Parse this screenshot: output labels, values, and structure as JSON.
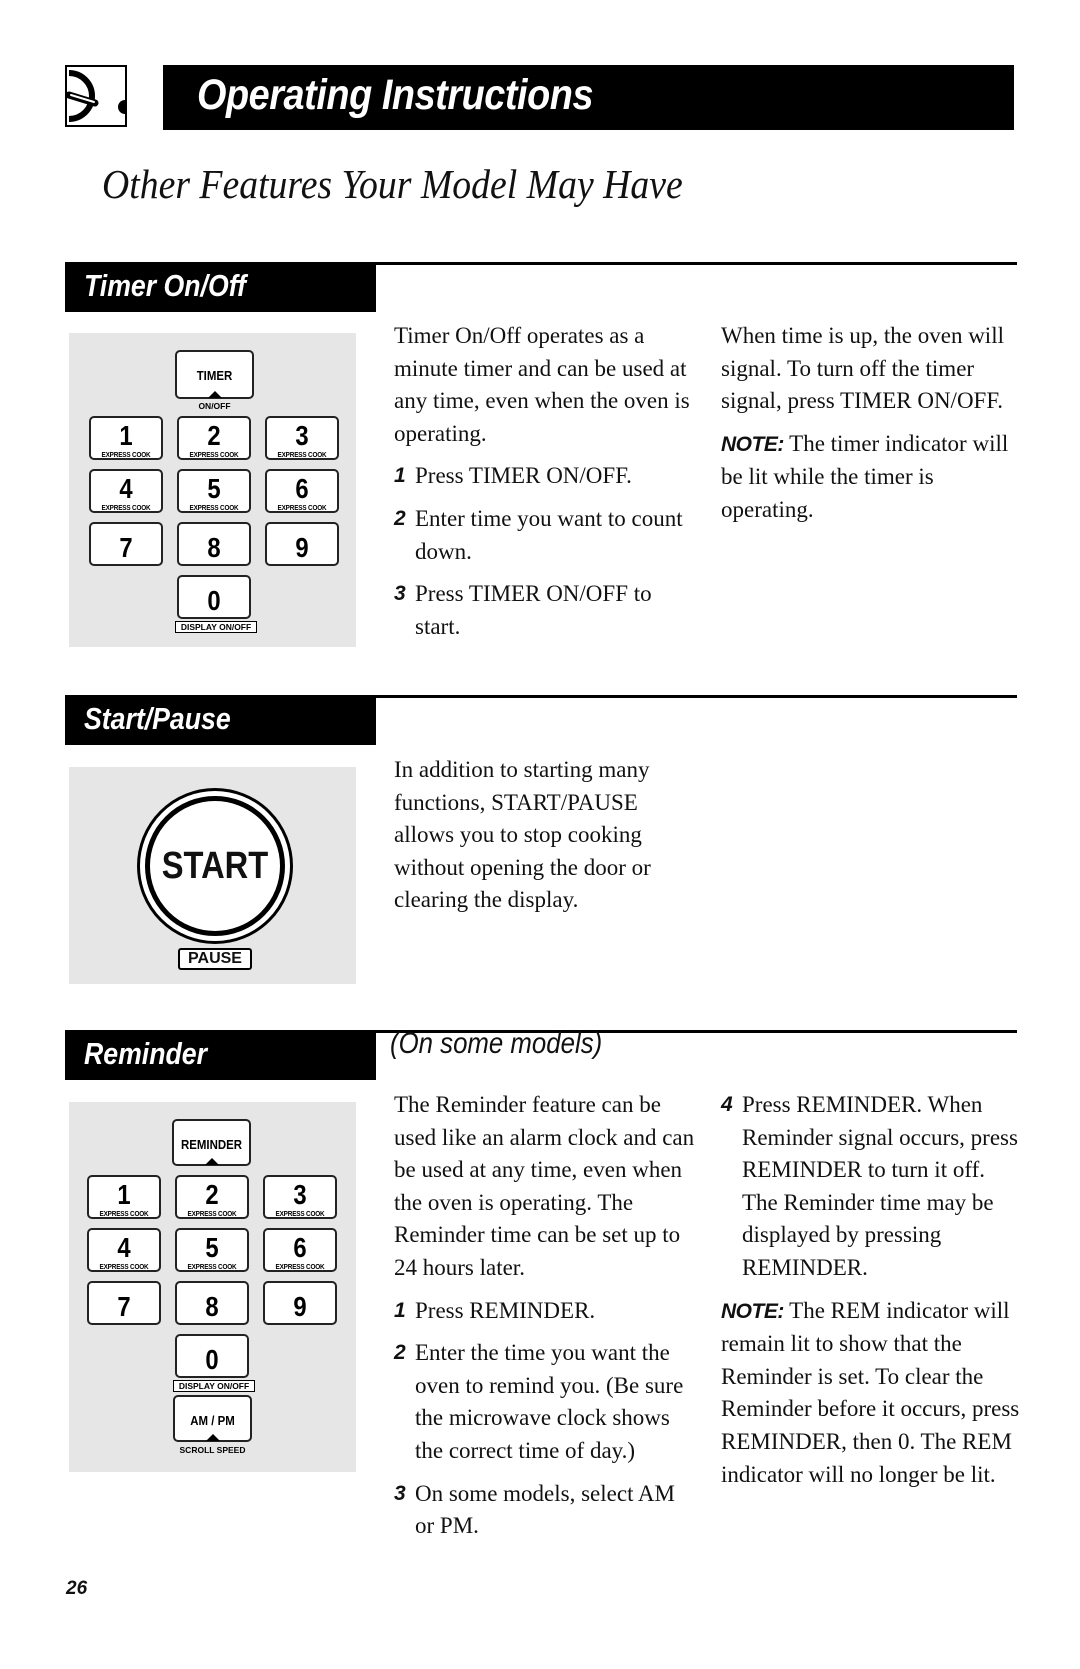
{
  "header": {
    "icon": "oven-dial-icon",
    "title": "Operating Instructions"
  },
  "page_subtitle": "Other Features Your Model May Have",
  "sections": {
    "timer": {
      "label": "Timer On/Off",
      "keypad": {
        "top_key": "TIMER",
        "top_caption": "ON/OFF",
        "keys": [
          {
            "num": "1",
            "sub": "EXPRESS COOK"
          },
          {
            "num": "2",
            "sub": "EXPRESS COOK"
          },
          {
            "num": "3",
            "sub": "EXPRESS COOK"
          },
          {
            "num": "4",
            "sub": "EXPRESS COOK"
          },
          {
            "num": "5",
            "sub": "EXPRESS COOK"
          },
          {
            "num": "6",
            "sub": "EXPRESS COOK"
          },
          {
            "num": "7",
            "sub": ""
          },
          {
            "num": "8",
            "sub": ""
          },
          {
            "num": "9",
            "sub": ""
          }
        ],
        "zero_key": "0",
        "zero_caption": "DISPLAY ON/OFF"
      },
      "intro": "Timer On/Off operates as a minute timer and can be used at any time, even when the oven is operating.",
      "steps": [
        {
          "n": "1",
          "text": "Press TIMER ON/OFF."
        },
        {
          "n": "2",
          "text": "Enter time you want to count down."
        },
        {
          "n": "3",
          "text": "Press TIMER ON/OFF to start."
        }
      ],
      "right_text": "When time is up, the oven will signal. To turn off the timer signal, press TIMER ON/OFF.",
      "note_label": "NOTE:",
      "note_text": " The timer indicator will be lit while the timer is operating."
    },
    "start_pause": {
      "label": "Start/Pause",
      "button_label": "START",
      "button_caption": "PAUSE",
      "text": "In addition to starting many functions, START/PAUSE allows you to stop cooking without opening the door or clearing the display."
    },
    "reminder": {
      "label": "Reminder",
      "qualifier": "(On some models)",
      "keypad": {
        "top_key": "REMINDER",
        "keys": [
          {
            "num": "1",
            "sub": "EXPRESS COOK"
          },
          {
            "num": "2",
            "sub": "EXPRESS COOK"
          },
          {
            "num": "3",
            "sub": "EXPRESS COOK"
          },
          {
            "num": "4",
            "sub": "EXPRESS COOK"
          },
          {
            "num": "5",
            "sub": "EXPRESS COOK"
          },
          {
            "num": "6",
            "sub": "EXPRESS COOK"
          },
          {
            "num": "7",
            "sub": ""
          },
          {
            "num": "8",
            "sub": ""
          },
          {
            "num": "9",
            "sub": ""
          }
        ],
        "zero_key": "0",
        "zero_caption": "DISPLAY ON/OFF",
        "ampm_key": "AM / PM",
        "ampm_caption": "SCROLL SPEED"
      },
      "intro": "The Reminder feature can be used like an alarm clock and can be used at any time, even when the oven is operating. The Reminder time can be set up to 24 hours later.",
      "steps": [
        {
          "n": "1",
          "text": "Press REMINDER."
        },
        {
          "n": "2",
          "text": "Enter the time you want the oven to remind you. (Be sure the microwave clock shows the correct time of day.)"
        },
        {
          "n": "3",
          "text": "On some models, select AM or PM."
        },
        {
          "n": "4",
          "text": "Press REMINDER. When Reminder signal occurs, press REMINDER to turn it off. The Reminder time may be displayed by pressing REMINDER."
        }
      ],
      "note_label": "NOTE:",
      "note_text": " The REM indicator will remain lit to show that the Reminder is set. To clear the Reminder before it occurs, press REMINDER, then 0. The REM indicator will no longer be lit."
    }
  },
  "page_number": "26"
}
